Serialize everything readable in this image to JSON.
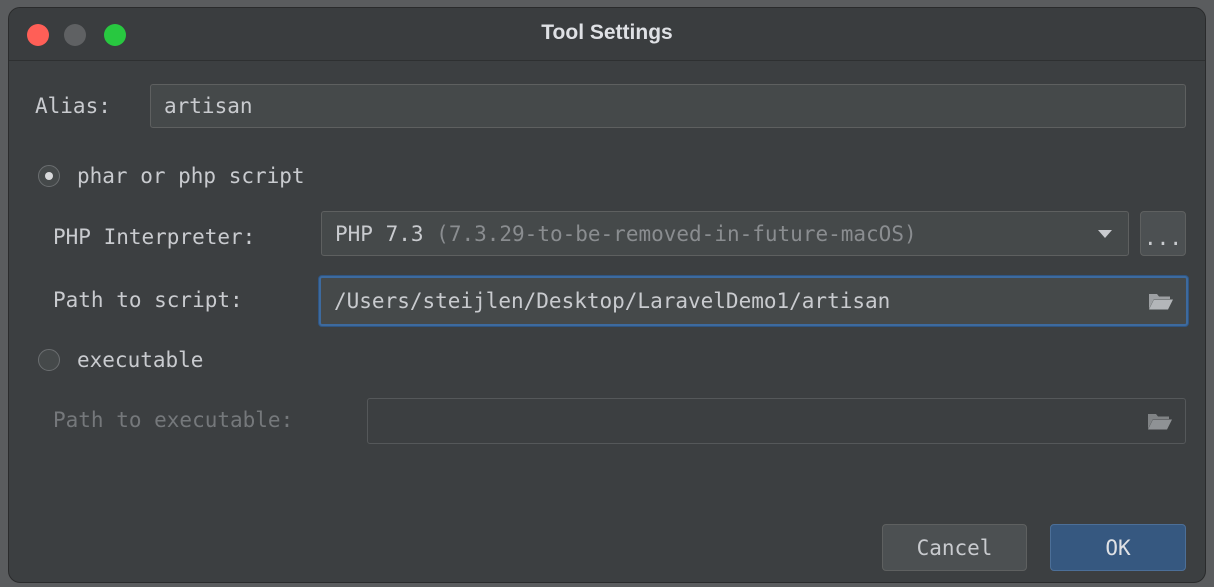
{
  "window": {
    "title": "Tool Settings"
  },
  "alias": {
    "label": "Alias:",
    "value": "artisan"
  },
  "mode": {
    "phar_label": "phar or php script",
    "phar_selected": true,
    "executable_label": "executable",
    "executable_selected": false
  },
  "interpreter": {
    "label": "PHP Interpreter:",
    "selected_name": "PHP 7.3",
    "selected_version": "(7.3.29-to-be-removed-in-future-macOS)",
    "browse_label": "..."
  },
  "script_path": {
    "label": "Path to script:",
    "value": "/Users/steijlen/Desktop/LaravelDemo1/artisan"
  },
  "executable_path": {
    "label": "Path to executable:",
    "value": ""
  },
  "buttons": {
    "cancel": "Cancel",
    "ok": "OK"
  },
  "colors": {
    "accent": "#365880",
    "focus_border": "#3d6a9e",
    "close": "#ff5f57",
    "minimize": "#5f6163",
    "maximize": "#28c840"
  },
  "icons": {
    "folder": "folder-icon",
    "dropdown": "chevron-down-icon"
  }
}
